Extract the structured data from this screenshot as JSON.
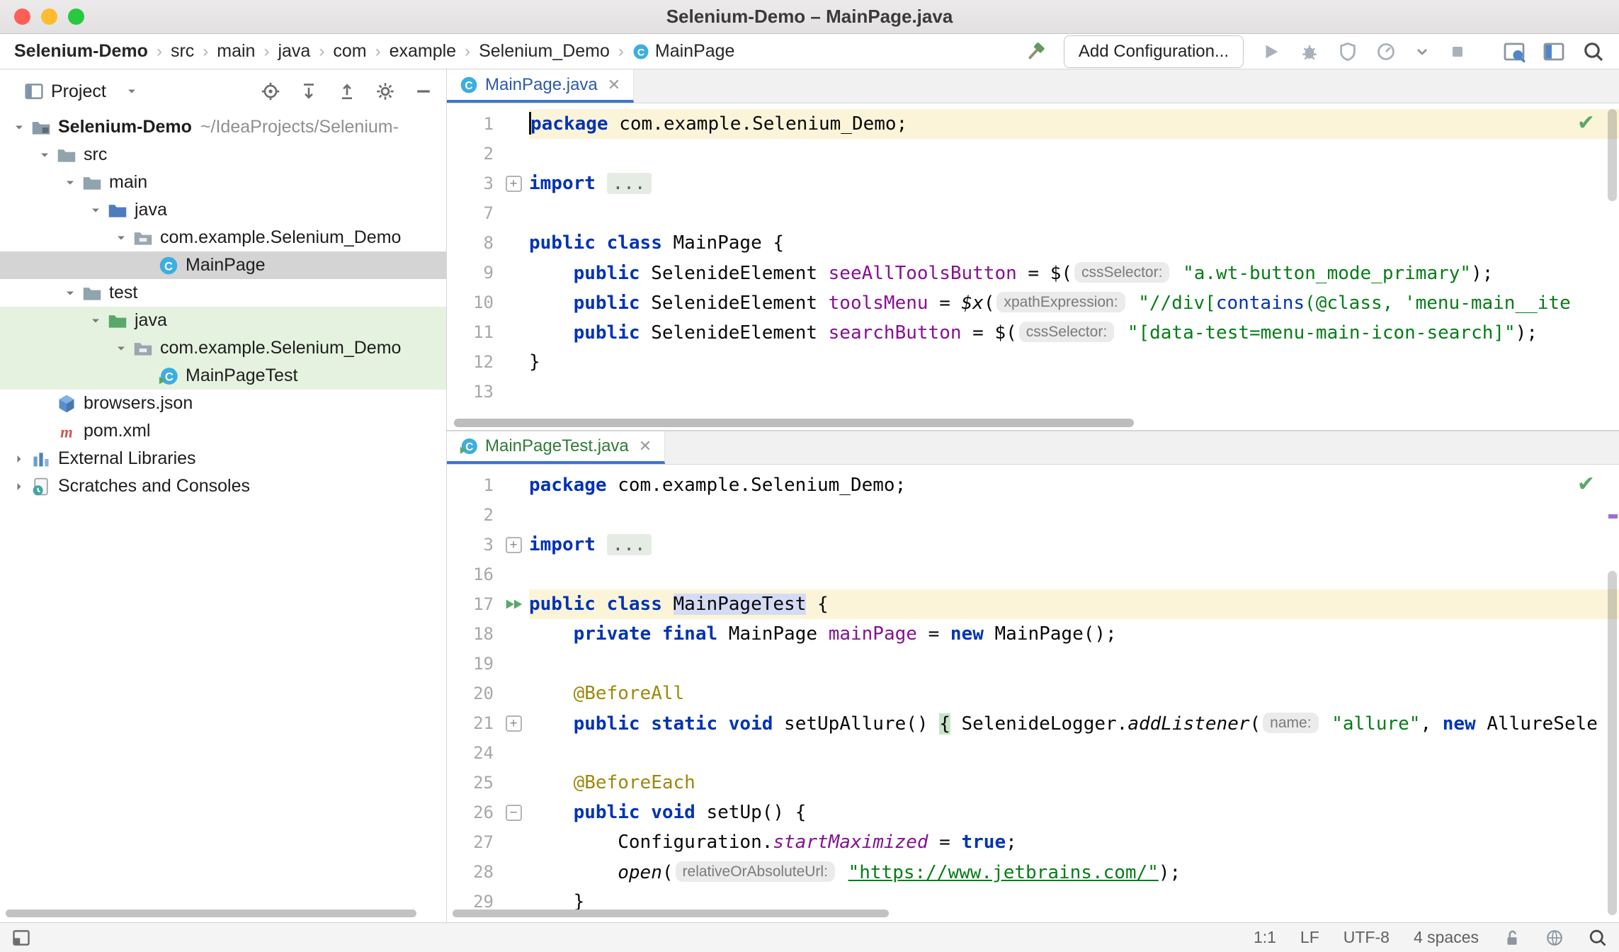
{
  "window": {
    "title": "Selenium-Demo – MainPage.java"
  },
  "breadcrumbs": [
    {
      "label": "Selenium-Demo",
      "bold": true
    },
    {
      "label": "src"
    },
    {
      "label": "main"
    },
    {
      "label": "java"
    },
    {
      "label": "com"
    },
    {
      "label": "example"
    },
    {
      "label": "Selenium_Demo"
    },
    {
      "label": "MainPage",
      "icon": "class"
    }
  ],
  "toolbar": {
    "add_configuration": "Add Configuration..."
  },
  "project_panel": {
    "title": "Project",
    "tree": [
      {
        "label": "Selenium-Demo",
        "sub": "~/IdeaProjects/Selenium-",
        "icon": "folder-project",
        "depth": 0,
        "chevron": "down",
        "bold": true
      },
      {
        "label": "src",
        "icon": "folder",
        "depth": 1,
        "chevron": "down"
      },
      {
        "label": "main",
        "icon": "folder",
        "depth": 2,
        "chevron": "down"
      },
      {
        "label": "java",
        "icon": "folder-source",
        "depth": 3,
        "chevron": "down"
      },
      {
        "label": "com.example.Selenium_Demo",
        "icon": "package",
        "depth": 4,
        "chevron": "down"
      },
      {
        "label": "MainPage",
        "icon": "class",
        "depth": 5,
        "state": "selected"
      },
      {
        "label": "test",
        "icon": "folder",
        "depth": 2,
        "chevron": "down"
      },
      {
        "label": "java",
        "icon": "folder-test",
        "depth": 3,
        "chevron": "down",
        "state": "added"
      },
      {
        "label": "com.example.Selenium_Demo",
        "icon": "package",
        "depth": 4,
        "chevron": "down",
        "state": "added"
      },
      {
        "label": "MainPageTest",
        "icon": "test-class",
        "depth": 5,
        "state": "added"
      },
      {
        "label": "browsers.json",
        "icon": "json",
        "depth": 1
      },
      {
        "label": "pom.xml",
        "icon": "maven",
        "depth": 1
      },
      {
        "label": "External Libraries",
        "icon": "libraries",
        "depth": 0,
        "chevron": "right"
      },
      {
        "label": "Scratches and Consoles",
        "icon": "scratches",
        "depth": 0,
        "chevron": "right"
      }
    ]
  },
  "editors": [
    {
      "tab": "MainPage.java",
      "lines": [
        {
          "n": "1",
          "hl": true,
          "caret": true,
          "tokens": [
            [
              "k",
              "package"
            ],
            [
              "p",
              " com.example.Selenium_Demo;"
            ]
          ]
        },
        {
          "n": "2",
          "tokens": []
        },
        {
          "n": "3",
          "fold": "plus",
          "tokens": [
            [
              "k",
              "import"
            ],
            [
              "p",
              " "
            ],
            [
              "fold",
              "..."
            ]
          ]
        },
        {
          "n": "7",
          "tokens": []
        },
        {
          "n": "8",
          "tokens": [
            [
              "k",
              "public"
            ],
            [
              "p",
              " "
            ],
            [
              "k",
              "class"
            ],
            [
              "p",
              " MainPage {"
            ]
          ]
        },
        {
          "n": "9",
          "tokens": [
            [
              "p",
              "    "
            ],
            [
              "k",
              "public"
            ],
            [
              "p",
              " SelenideElement "
            ],
            [
              "f",
              "seeAllToolsButton"
            ],
            [
              "p",
              " = $("
            ],
            [
              "h",
              "cssSelector:"
            ],
            [
              "p",
              " "
            ],
            [
              "s",
              "\"a.wt-button_mode_primary\""
            ],
            [
              "p",
              ");"
            ]
          ]
        },
        {
          "n": "10",
          "tokens": [
            [
              "p",
              "    "
            ],
            [
              "k",
              "public"
            ],
            [
              "p",
              " SelenideElement "
            ],
            [
              "f",
              "toolsMenu"
            ],
            [
              "p",
              " = "
            ],
            [
              "m",
              "$x"
            ],
            [
              "p",
              "("
            ],
            [
              "h",
              "xpathExpression:"
            ],
            [
              "p",
              " "
            ],
            [
              "s",
              "\"//div["
            ],
            [
              "xf",
              "contains"
            ],
            [
              "s",
              "(@class, 'menu-main__ite"
            ]
          ]
        },
        {
          "n": "11",
          "tokens": [
            [
              "p",
              "    "
            ],
            [
              "k",
              "public"
            ],
            [
              "p",
              " SelenideElement "
            ],
            [
              "f",
              "searchButton"
            ],
            [
              "p",
              " = $("
            ],
            [
              "h",
              "cssSelector:"
            ],
            [
              "p",
              " "
            ],
            [
              "s",
              "\"[data-test=menu-main-icon-search]\""
            ],
            [
              "p",
              ");"
            ]
          ]
        },
        {
          "n": "12",
          "tokens": [
            [
              "p",
              "}"
            ]
          ]
        },
        {
          "n": "13",
          "tokens": []
        }
      ]
    },
    {
      "tab": "MainPageTest.java",
      "lines": [
        {
          "n": "1",
          "tokens": [
            [
              "k",
              "package"
            ],
            [
              "p",
              " com.example.Selenium_Demo;"
            ]
          ]
        },
        {
          "n": "2",
          "tokens": []
        },
        {
          "n": "3",
          "fold": "plus",
          "tokens": [
            [
              "k",
              "import"
            ],
            [
              "p",
              " "
            ],
            [
              "fold",
              "..."
            ]
          ]
        },
        {
          "n": "16",
          "tokens": []
        },
        {
          "n": "17",
          "hl": true,
          "run": true,
          "tokens": [
            [
              "k",
              "public"
            ],
            [
              "p",
              " "
            ],
            [
              "k",
              "class"
            ],
            [
              "p",
              " "
            ],
            [
              "idhl",
              "MainPageTest"
            ],
            [
              "p",
              " {"
            ]
          ]
        },
        {
          "n": "18",
          "tokens": [
            [
              "p",
              "    "
            ],
            [
              "k",
              "private"
            ],
            [
              "p",
              " "
            ],
            [
              "k",
              "final"
            ],
            [
              "p",
              " MainPage "
            ],
            [
              "f",
              "mainPage"
            ],
            [
              "p",
              " = "
            ],
            [
              "k",
              "new"
            ],
            [
              "p",
              " MainPage();"
            ]
          ]
        },
        {
          "n": "19",
          "tokens": []
        },
        {
          "n": "20",
          "tokens": [
            [
              "p",
              "    "
            ],
            [
              "a",
              "@BeforeAll"
            ]
          ]
        },
        {
          "n": "21",
          "fold": "plus",
          "tokens": [
            [
              "p",
              "    "
            ],
            [
              "k",
              "public"
            ],
            [
              "p",
              " "
            ],
            [
              "k",
              "static"
            ],
            [
              "p",
              " "
            ],
            [
              "k",
              "void"
            ],
            [
              "p",
              " setUpAllure() "
            ],
            [
              "bh",
              "{"
            ],
            [
              "p",
              " SelenideLogger."
            ],
            [
              "m",
              "addListener"
            ],
            [
              "p",
              "("
            ],
            [
              "h",
              "name:"
            ],
            [
              "p",
              " "
            ],
            [
              "s",
              "\"allure\""
            ],
            [
              "p",
              ", "
            ],
            [
              "k",
              "new"
            ],
            [
              "p",
              " AllureSele"
            ]
          ]
        },
        {
          "n": "24",
          "tokens": []
        },
        {
          "n": "25",
          "tokens": [
            [
              "p",
              "    "
            ],
            [
              "a",
              "@BeforeEach"
            ]
          ]
        },
        {
          "n": "26",
          "fold": "minus",
          "tokens": [
            [
              "p",
              "    "
            ],
            [
              "k",
              "public"
            ],
            [
              "p",
              " "
            ],
            [
              "k",
              "void"
            ],
            [
              "p",
              " setUp() {"
            ]
          ]
        },
        {
          "n": "27",
          "tokens": [
            [
              "p",
              "        Configuration."
            ],
            [
              "fi",
              "startMaximized"
            ],
            [
              "p",
              " = "
            ],
            [
              "k",
              "true"
            ],
            [
              "p",
              ";"
            ]
          ]
        },
        {
          "n": "28",
          "tokens": [
            [
              "p",
              "        "
            ],
            [
              "m",
              "open"
            ],
            [
              "p",
              "("
            ],
            [
              "h",
              "relativeOrAbsoluteUrl:"
            ],
            [
              "p",
              " "
            ],
            [
              "su",
              "\"https://www.jetbrains.com/\""
            ],
            [
              "p",
              ");"
            ]
          ]
        },
        {
          "n": "29",
          "tokens": [
            [
              "p",
              "    }"
            ]
          ]
        }
      ]
    }
  ],
  "status_bar": {
    "caret_position": "1:1",
    "line_separator": "LF",
    "encoding": "UTF-8",
    "indent": "4 spaces"
  },
  "colors": {
    "keyword": "#0033B3",
    "string": "#067D17",
    "field": "#871094",
    "annotation": "#9E880D",
    "added_green": "#2F7B34",
    "modified_blue": "#2E5AA6",
    "run_green": "#59A869"
  }
}
